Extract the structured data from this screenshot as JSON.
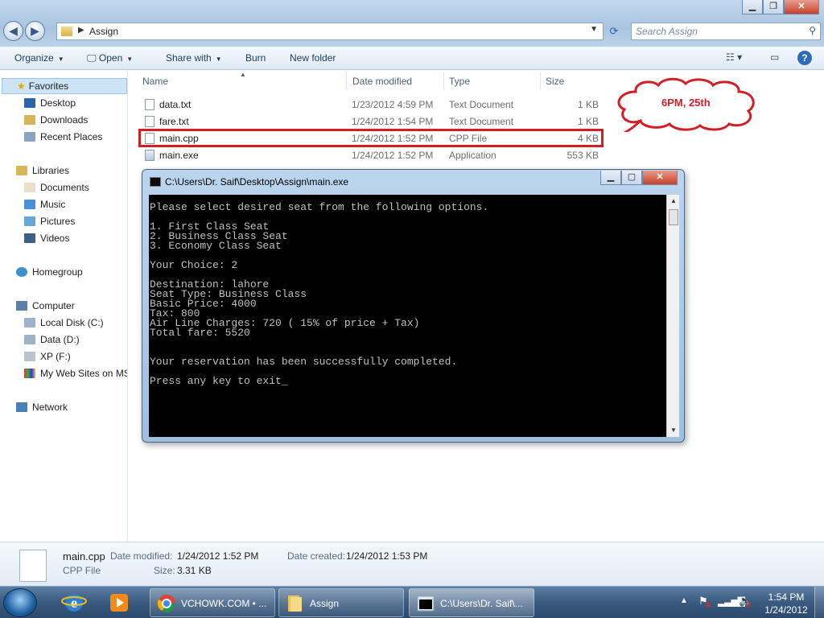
{
  "explorer": {
    "address": "Assign",
    "search_placeholder": "Search Assign",
    "toolbar": {
      "organize": "Organize",
      "open": "Open",
      "share_with": "Share with",
      "burn": "Burn",
      "new_folder": "New folder"
    },
    "nav": {
      "favorites": "Favorites",
      "desktop": "Desktop",
      "downloads": "Downloads",
      "recent_places": "Recent Places",
      "libraries": "Libraries",
      "documents": "Documents",
      "music": "Music",
      "pictures": "Pictures",
      "videos": "Videos",
      "homegroup": "Homegroup",
      "computer": "Computer",
      "local_disk": "Local Disk (C:)",
      "data_d": "Data (D:)",
      "xp_f": "XP (F:)",
      "web_sites": "My Web Sites on MS",
      "network": "Network"
    },
    "columns": {
      "name": "Name",
      "date_modified": "Date modified",
      "type": "Type",
      "size": "Size"
    },
    "files": [
      {
        "name": "data.txt",
        "date": "1/23/2012 4:59 PM",
        "type": "Text Document",
        "size": "1 KB"
      },
      {
        "name": "fare.txt",
        "date": "1/24/2012 1:54 PM",
        "type": "Text Document",
        "size": "1 KB"
      },
      {
        "name": "main.cpp",
        "date": "1/24/2012 1:52 PM",
        "type": "CPP File",
        "size": "4 KB"
      },
      {
        "name": "main.exe",
        "date": "1/24/2012 1:52 PM",
        "type": "Application",
        "size": "553 KB"
      }
    ],
    "annotation": "6PM, 25th",
    "details": {
      "filename": "main.cpp",
      "type": "CPP File",
      "date_modified_label": "Date modified:",
      "date_modified": "1/24/2012 1:52 PM",
      "date_created_label": "Date created:",
      "date_created": "1/24/2012 1:53 PM",
      "size_label": "Size:",
      "size": "3.31 KB"
    }
  },
  "console": {
    "title": "C:\\Users\\Dr. Saif\\Desktop\\Assign\\main.exe",
    "output": "Please select desired seat from the following options.\n\n1. First Class Seat\n2. Business Class Seat\n3. Economy Class Seat\n\nYour Choice: 2\n\nDestination: lahore\nSeat Type: Business Class\nBasic Price: 4000\nTax: 800\nAir Line Charges: 720 ( 15% of price + Tax)\nTotal fare: 5520\n\n\nYour reservation has been successfully completed.\n\nPress any key to exit_"
  },
  "taskbar": {
    "tasks": [
      {
        "label": "VCHOWK.COM • ..."
      },
      {
        "label": "Assign"
      },
      {
        "label": "C:\\Users\\Dr. Saif\\..."
      }
    ],
    "time": "1:54 PM",
    "date": "1/24/2012"
  }
}
